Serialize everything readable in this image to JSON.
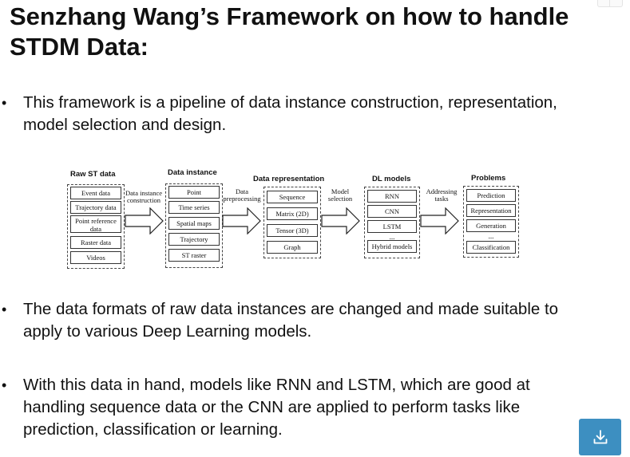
{
  "slide": {
    "title_line1": "Senzhang Wang’s Framework on how to handle",
    "title_line2": "STDM Data:",
    "bullets": [
      {
        "line1": "This framework is a pipeline of data instance construction, representation,",
        "line2": "model selection and design."
      },
      {
        "line1": "The data formats of raw data instances are changed and made suitable to",
        "line2": "apply to various Deep Learning models."
      },
      {
        "line1": "With this data in hand, models like RNN and LSTM, which are good at",
        "line2": "handling sequence data or the CNN are applied to perform tasks like",
        "line3": "prediction, classification or learning."
      }
    ],
    "bullet_glyph": "•"
  },
  "diagram": {
    "raw": {
      "heading": "Raw ST data",
      "items": [
        "Event data",
        "Trajectory data",
        "Point reference data",
        "Raster data",
        "Videos"
      ]
    },
    "instance": {
      "heading": "Data instance",
      "items": [
        "Point",
        "Time series",
        "Spatial maps",
        "Trajectory",
        "ST raster"
      ]
    },
    "representation": {
      "heading": "Data representation",
      "items": [
        "Sequence",
        "Matrix (2D)",
        "Tensor (3D)",
        "Graph"
      ]
    },
    "models": {
      "heading": "DL models",
      "items": [
        "RNN",
        "CNN",
        "LSTM",
        "...",
        "Hybrid models"
      ]
    },
    "problems": {
      "heading": "Problems",
      "items": [
        "Prediction",
        "Representation",
        "Generation",
        "...",
        "Classification"
      ]
    },
    "steps": {
      "construction": "Data instance construction",
      "preprocessing": "Data preprocessing",
      "selection": "Model selection",
      "addressing": "Addressing tasks"
    }
  },
  "colors": {
    "button": "#3d8fc1",
    "text": "#111111"
  },
  "icons": {
    "download": "download-icon"
  }
}
